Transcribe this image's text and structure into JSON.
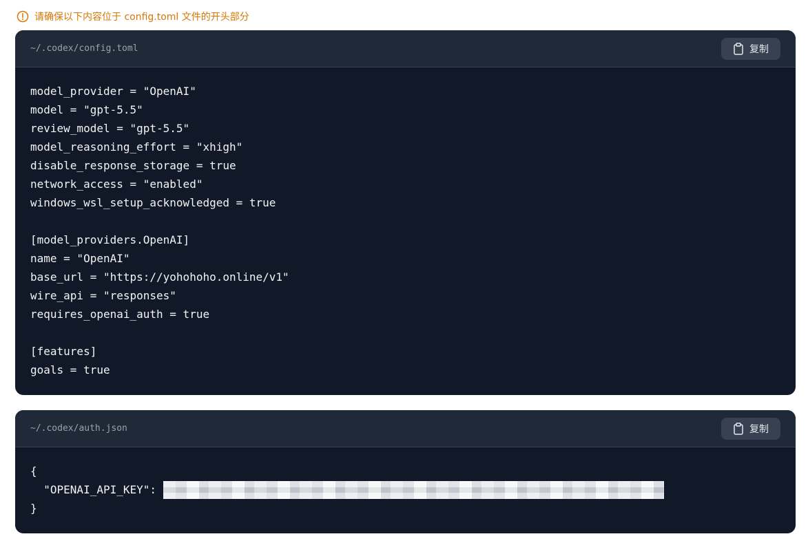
{
  "notice": {
    "text": "请确保以下内容位于 config.toml 文件的开头部分",
    "color": "#d97706",
    "icon": "info-circle-icon"
  },
  "blocks": [
    {
      "path": "~/.codex/config.toml",
      "copy_label": "复制",
      "copy_icon": "clipboard-icon",
      "lines": [
        "model_provider = \"OpenAI\"",
        "model = \"gpt-5.5\"",
        "review_model = \"gpt-5.5\"",
        "model_reasoning_effort = \"xhigh\"",
        "disable_response_storage = true",
        "network_access = \"enabled\"",
        "windows_wsl_setup_acknowledged = true",
        "",
        "[model_providers.OpenAI]",
        "name = \"OpenAI\"",
        "base_url = \"https://yohohoho.online/v1\"",
        "wire_api = \"responses\"",
        "requires_openai_auth = true",
        "",
        "[features]",
        "goals = true"
      ]
    },
    {
      "path": "~/.codex/auth.json",
      "copy_label": "复制",
      "copy_icon": "clipboard-icon",
      "lines": [
        "{",
        "  \"OPENAI_API_KEY\": ",
        "}"
      ]
    }
  ],
  "colors": {
    "code_bg": "#111827",
    "header_bg": "#1f2937",
    "button_bg": "#374151",
    "code_text": "#f3f4f6",
    "path_text": "#9ca3af"
  }
}
